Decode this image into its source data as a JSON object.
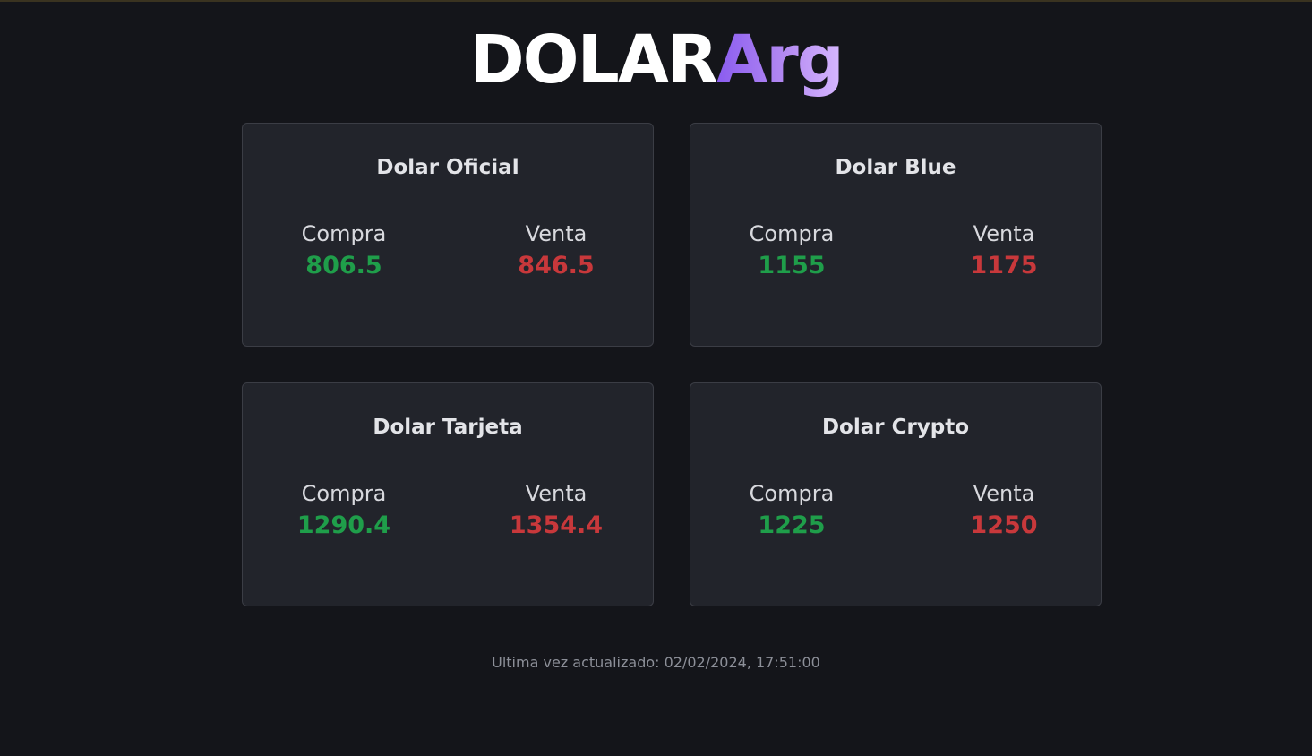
{
  "header": {
    "logo_part1": "DOLAR",
    "logo_part2": "Arg"
  },
  "colors": {
    "background": "#14151a",
    "card": "#22242b",
    "buy": "#1f9e4a",
    "sell": "#c8383b",
    "accent": "#a070f0"
  },
  "cards": [
    {
      "title": "Dolar Oficial",
      "buy_label": "Compra",
      "buy_value": "806.5",
      "sell_label": "Venta",
      "sell_value": "846.5"
    },
    {
      "title": "Dolar Blue",
      "buy_label": "Compra",
      "buy_value": "1155",
      "sell_label": "Venta",
      "sell_value": "1175"
    },
    {
      "title": "Dolar Tarjeta",
      "buy_label": "Compra",
      "buy_value": "1290.4",
      "sell_label": "Venta",
      "sell_value": "1354.4"
    },
    {
      "title": "Dolar Crypto",
      "buy_label": "Compra",
      "buy_value": "1225",
      "sell_label": "Venta",
      "sell_value": "1250"
    }
  ],
  "footer": {
    "updated_text": "Ultima vez actualizado: 02/02/2024, 17:51:00"
  }
}
